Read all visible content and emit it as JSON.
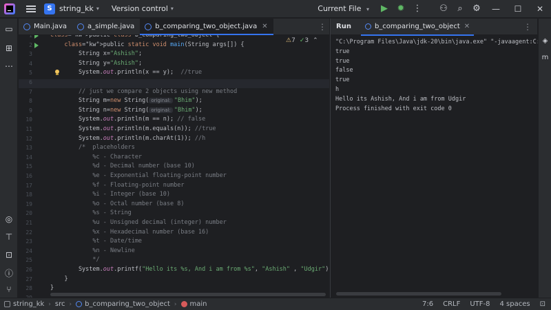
{
  "titlebar": {
    "project_badge": "S",
    "project_name": "string_kk",
    "vcs_label": "Version control",
    "run_config": "Current File",
    "icons": [
      "hamburger-icon",
      "play-icon",
      "debug-icon",
      "more-icon",
      "add-user-icon",
      "search-icon",
      "settings-icon",
      "minimize-icon",
      "maximize-icon",
      "close-icon"
    ]
  },
  "editor": {
    "tabs": [
      {
        "label": "Main.java",
        "active": false
      },
      {
        "label": "a_simple.java",
        "active": false
      },
      {
        "label": "b_comparing_two_object.java",
        "active": true
      }
    ],
    "warnings": "7",
    "checks": "3",
    "current_line": 7,
    "hint_label": "original:",
    "lines": [
      {
        "n": "1",
        "text": "public class b_comparing_two_object {"
      },
      {
        "n": "2",
        "text": "    public static void main(String args[]) {"
      },
      {
        "n": "3",
        "text": "        String x=\"Ashish\";"
      },
      {
        "n": "4",
        "text": "        String y=\"Ashish\";"
      },
      {
        "n": "5",
        "text": "        System.out.println(x == y);  //true"
      },
      {
        "n": "6",
        "text": ""
      },
      {
        "n": "7",
        "text": "        // just we compare 2 objects using new method"
      },
      {
        "n": "8",
        "text": "        String m=new String( \"Bhim\");"
      },
      {
        "n": "9",
        "text": "        String n=new String( \"Bhim\");"
      },
      {
        "n": "10",
        "text": "        System.out.println(m == n); // false"
      },
      {
        "n": "11",
        "text": "        System.out.println(m.equals(n)); //true"
      },
      {
        "n": "12",
        "text": "        System.out.println(m.charAt(1)); //h"
      },
      {
        "n": "13",
        "text": "        /*  placeholders"
      },
      {
        "n": "14",
        "text": "            %c - Character"
      },
      {
        "n": "15",
        "text": "            %d - Decimal number (base 10)"
      },
      {
        "n": "16",
        "text": "            %e - Exponential floating-point number"
      },
      {
        "n": "17",
        "text": "            %f - Floating-point number"
      },
      {
        "n": "18",
        "text": "            %i - Integer (base 10)"
      },
      {
        "n": "19",
        "text": "            %o - Octal number (base 8)"
      },
      {
        "n": "20",
        "text": "            %s - String"
      },
      {
        "n": "21",
        "text": "            %u - Unsigned decimal (integer) number"
      },
      {
        "n": "22",
        "text": "            %x - Hexadecimal number (base 16)"
      },
      {
        "n": "23",
        "text": "            %t - Date/time"
      },
      {
        "n": "24",
        "text": "            %n - Newline"
      },
      {
        "n": "25",
        "text": "            */"
      },
      {
        "n": "26",
        "text": "        System.out.printf(\"Hello its %s, And i am from %s\", \"Ashish\" , \"Udgir\");"
      },
      {
        "n": "27",
        "text": "    }"
      },
      {
        "n": "28",
        "text": "}"
      },
      {
        "n": "29",
        "text": ""
      }
    ]
  },
  "run": {
    "title": "Run",
    "tab_label": "b_comparing_two_object",
    "console": [
      "\"C:\\Program Files\\Java\\jdk-20\\bin\\java.exe\" \"-javaagent:C:",
      "true",
      "true",
      "false",
      "true",
      "h",
      "Hello its Ashish, And i am from Udgir",
      "Process finished with exit code 0"
    ]
  },
  "statusbar": {
    "breadcrumbs": [
      "string_kk",
      "src",
      "b_comparing_two_object",
      "main"
    ],
    "position": "7:6",
    "line_sep": "CRLF",
    "encoding": "UTF-8",
    "indent": "4 spaces"
  }
}
